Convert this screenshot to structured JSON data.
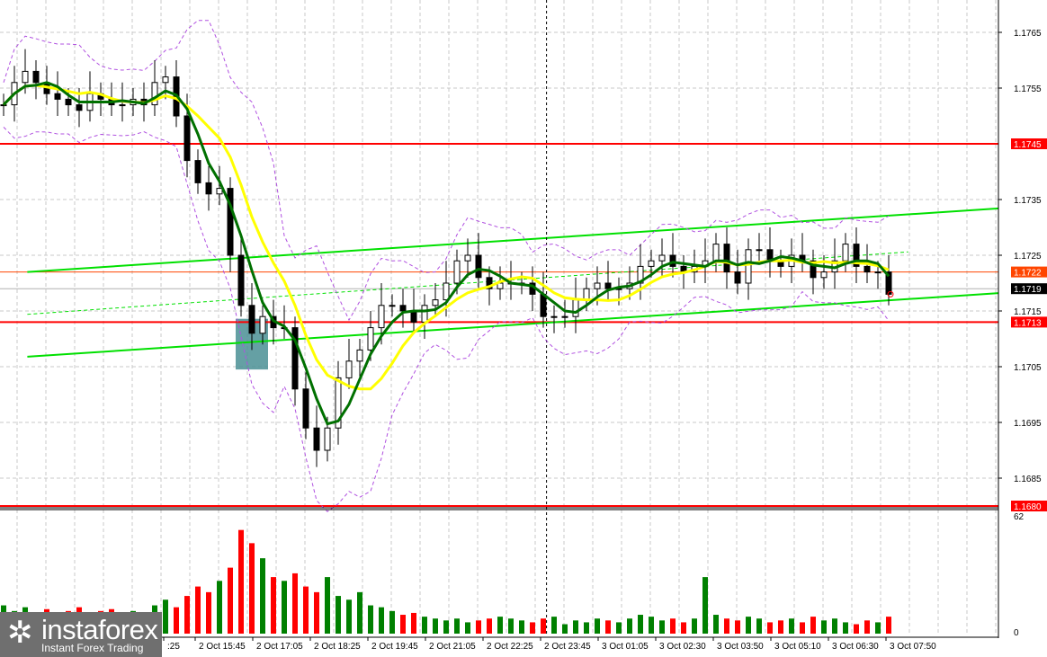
{
  "chart_data": {
    "type": "candlestick",
    "symbol_note": "",
    "y_ticks": [
      "1.1765",
      "1.1755",
      "1.1735",
      "1.1725",
      "1.1715",
      "1.1705",
      "1.1695",
      "1.1685"
    ],
    "y_tick_values": [
      1.1765,
      1.1755,
      1.1735,
      1.1725,
      1.1715,
      1.1705,
      1.1695,
      1.1685
    ],
    "price_labels": [
      {
        "text": "1.1745",
        "value": 1.1745,
        "color": "#ff0000"
      },
      {
        "text": "1.1722",
        "value": 1.1722,
        "color": "#ff4500"
      },
      {
        "text": "1.1719",
        "value": 1.1719,
        "color": "#000000"
      },
      {
        "text": "1.1713",
        "value": 1.1713,
        "color": "#ff0000"
      },
      {
        "text": "1.1680",
        "value": 1.168,
        "color": "#ff0000"
      }
    ],
    "volume_axis": {
      "max_label": "62",
      "min_label": "0",
      "max": 62
    },
    "x_labels": [
      ":25",
      "2 Oct 15:45",
      "2 Oct 17:05",
      "2 Oct 18:25",
      "2 Oct 19:45",
      "2 Oct 21:05",
      "2 Oct 22:25",
      "2 Oct 23:45",
      "3 Oct 01:05",
      "3 Oct 02:30",
      "3 Oct 03:50",
      "3 Oct 05:10",
      "3 Oct 06:30",
      "3 Oct 07:50"
    ],
    "closes": [
      1.1752,
      1.1756,
      1.1758,
      1.1756,
      1.1754,
      1.1753,
      1.1752,
      1.1751,
      1.1754,
      1.1753,
      1.1752,
      1.1752,
      1.1753,
      1.1752,
      1.1756,
      1.1757,
      1.175,
      1.1742,
      1.1738,
      1.1736,
      1.1737,
      1.1725,
      1.1716,
      1.1711,
      1.1714,
      1.1712,
      1.1712,
      1.1701,
      1.1694,
      1.169,
      1.1694,
      1.1703,
      1.1706,
      1.1708,
      1.1712,
      1.1716,
      1.1716,
      1.1715,
      1.1713,
      1.1716,
      1.1717,
      1.172,
      1.1724,
      1.1725,
      1.1721,
      1.1719,
      1.172,
      1.172,
      1.172,
      1.1718,
      1.1714,
      1.1714,
      1.1714,
      1.1717,
      1.1719,
      1.172,
      1.1719,
      1.1719,
      1.172,
      1.1723,
      1.1724,
      1.1725,
      1.1723,
      1.1722,
      1.1723,
      1.1724,
      1.1727,
      1.1722,
      1.172,
      1.1726,
      1.1726,
      1.1724,
      1.1723,
      1.1725,
      1.1724,
      1.1721,
      1.1722,
      1.1724,
      1.1727,
      1.1723,
      1.1722,
      1.1722,
      1.1718
    ],
    "volumes": [
      15,
      12,
      14,
      10,
      13,
      11,
      12,
      14,
      10,
      12,
      13,
      11,
      12,
      10,
      15,
      18,
      14,
      20,
      25,
      22,
      28,
      35,
      55,
      48,
      40,
      30,
      28,
      32,
      25,
      22,
      30,
      20,
      18,
      22,
      15,
      14,
      12,
      10,
      11,
      9,
      8,
      7,
      8,
      6,
      7,
      8,
      9,
      8,
      7,
      6,
      8,
      9,
      5,
      7,
      6,
      8,
      7,
      6,
      8,
      10,
      9,
      7,
      8,
      6,
      8,
      30,
      10,
      8,
      7,
      9,
      8,
      6,
      7,
      8,
      6,
      9,
      7,
      8,
      6,
      5,
      7,
      6,
      9
    ],
    "channel_lines": [
      {
        "name": "upper",
        "from": [
          2.2,
          1.1722
        ],
        "to": [
          92.2,
          1.17334
        ],
        "dashed": false
      },
      {
        "name": "lower",
        "from": [
          2.2,
          1.17068
        ],
        "to": [
          92.2,
          1.17182
        ],
        "dashed": false
      },
      {
        "name": "mid",
        "from": [
          2.2,
          1.17144
        ],
        "to": [
          83.8,
          1.17256
        ],
        "dashed": true
      }
    ],
    "zone": {
      "from_bar": 21.5,
      "to_bar": 24.5,
      "top": 1.17136,
      "bottom": 1.17045
    },
    "cursor_bar": 50.3,
    "colors": {
      "up_volume": "#008000",
      "down_volume": "#ff0000",
      "fast_ma": "#007000",
      "slow_ma": "#ffff00",
      "bands": "#b050e0",
      "channel": "#00e000",
      "zone": "#4a8f94"
    }
  },
  "logo": {
    "name": "instaforex",
    "tagline": "Instant Forex Trading"
  }
}
